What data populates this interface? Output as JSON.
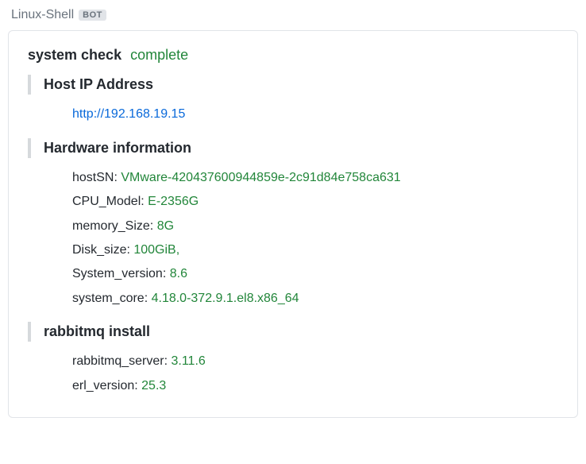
{
  "header": {
    "bot_name": "Linux-Shell",
    "bot_badge": "BOT"
  },
  "title": {
    "label": "system check",
    "status": "complete"
  },
  "sections": {
    "host_ip": {
      "heading": "Host IP Address",
      "link": "http://192.168.19.15"
    },
    "hardware": {
      "heading": "Hardware information",
      "items": [
        {
          "label": "hostSN:",
          "value": "VMware-420437600944859e-2c91d84e758ca631"
        },
        {
          "label": "CPU_Model:",
          "value": "E-2356G"
        },
        {
          "label": "memory_Size:",
          "value": "8G"
        },
        {
          "label": "Disk_size:",
          "value": "100GiB,"
        },
        {
          "label": "System_version:",
          "value": "8.6"
        },
        {
          "label": "system_core:",
          "value": "4.18.0-372.9.1.el8.x86_64"
        }
      ]
    },
    "rabbitmq": {
      "heading": "rabbitmq install",
      "items": [
        {
          "label": "rabbitmq_server:",
          "value": "3.11.6"
        },
        {
          "label": "erl_version:",
          "value": "25.3"
        }
      ]
    }
  }
}
